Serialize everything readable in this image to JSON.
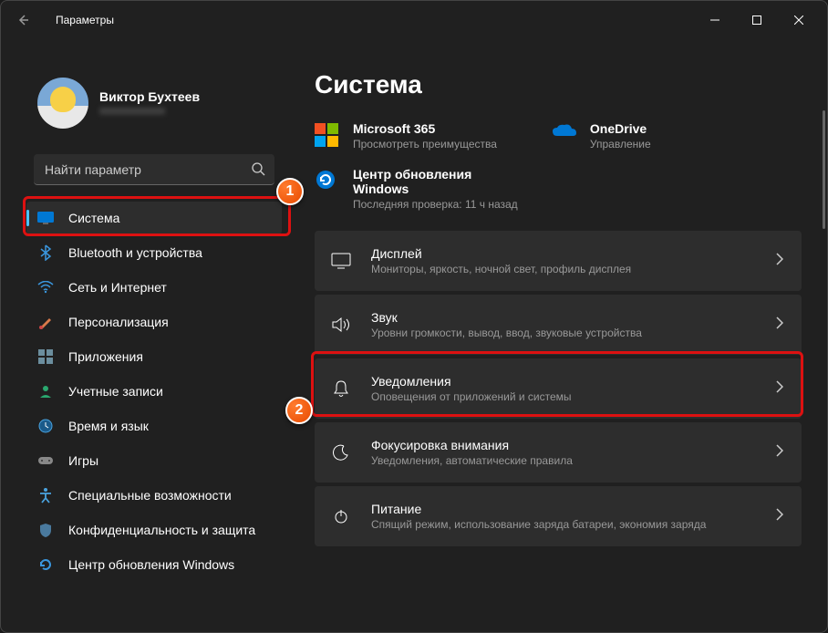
{
  "window": {
    "title": "Параметры"
  },
  "user": {
    "name": "Виктор Бухтеев",
    "email": "xxxxxxxxxxxx"
  },
  "search": {
    "placeholder": "Найти параметр"
  },
  "nav": [
    {
      "label": "Система"
    },
    {
      "label": "Bluetooth и устройства"
    },
    {
      "label": "Сеть и Интернет"
    },
    {
      "label": "Персонализация"
    },
    {
      "label": "Приложения"
    },
    {
      "label": "Учетные записи"
    },
    {
      "label": "Время и язык"
    },
    {
      "label": "Игры"
    },
    {
      "label": "Специальные возможности"
    },
    {
      "label": "Конфиденциальность и защита"
    },
    {
      "label": "Центр обновления Windows"
    }
  ],
  "page": {
    "title": "Система"
  },
  "top": {
    "m365": {
      "title": "Microsoft 365",
      "sub": "Просмотреть преимущества"
    },
    "onedrive": {
      "title": "OneDrive",
      "sub": "Управление"
    },
    "update": {
      "title": "Центр обновления Windows",
      "sub": "Последняя проверка: 11 ч назад"
    }
  },
  "rows": [
    {
      "title": "Дисплей",
      "sub": "Мониторы, яркость, ночной свет, профиль дисплея"
    },
    {
      "title": "Звук",
      "sub": "Уровни громкости, вывод, ввод, звуковые устройства"
    },
    {
      "title": "Уведомления",
      "sub": "Оповещения от приложений и системы"
    },
    {
      "title": "Фокусировка внимания",
      "sub": "Уведомления, автоматические правила"
    },
    {
      "title": "Питание",
      "sub": "Спящий режим, использование заряда батареи, экономия заряда"
    }
  ],
  "badges": {
    "b1": "1",
    "b2": "2"
  }
}
